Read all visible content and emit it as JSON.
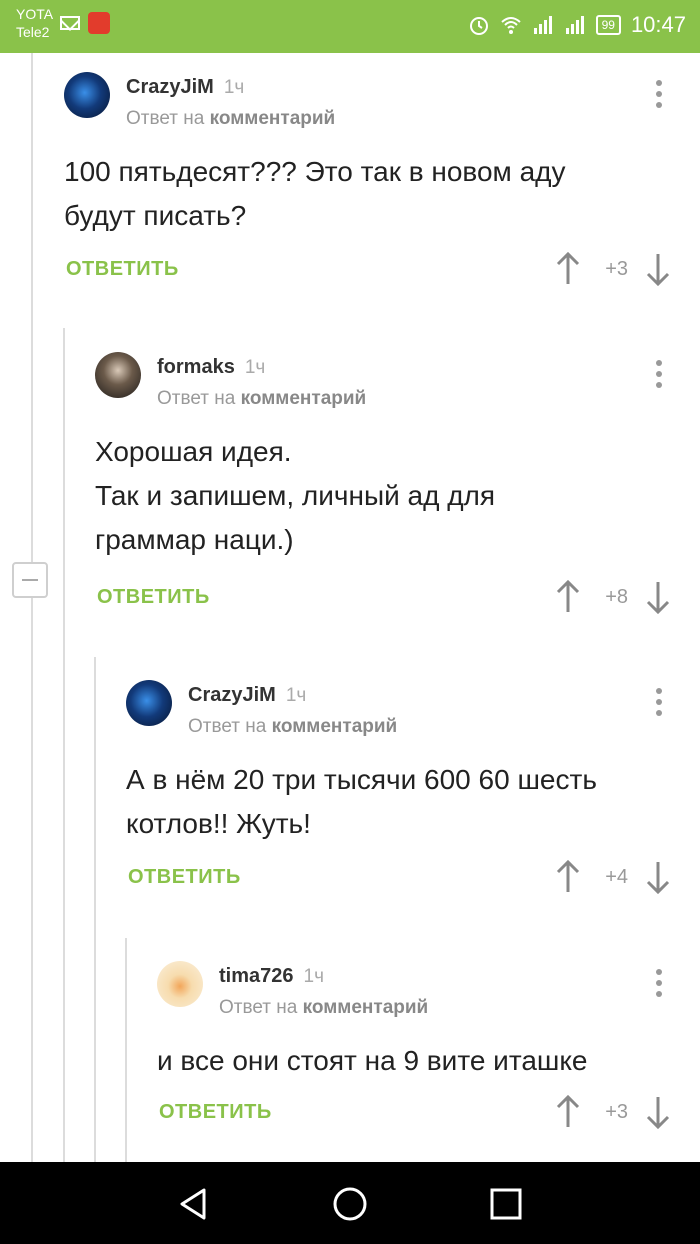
{
  "status_bar": {
    "carrier1": "YOTA",
    "carrier2": "Tele2",
    "battery": "99",
    "time": "10:47"
  },
  "comments": [
    {
      "author": "CrazyJiM",
      "time": "1ч",
      "reply_prefix": "Ответ на",
      "reply_target": "комментарий",
      "text": "100 пятьдесят??? Это так в новом аду\nбудут писать?",
      "reply_label": "ОТВЕТИТЬ",
      "score": "+3"
    },
    {
      "author": "formaks",
      "time": "1ч",
      "reply_prefix": "Ответ на",
      "reply_target": "комментарий",
      "text": "Хорошая идея.\nТак и запишем, личный ад для\nграммар наци.)",
      "reply_label": "ОТВЕТИТЬ",
      "score": "+8"
    },
    {
      "author": "CrazyJiM",
      "time": "1ч",
      "reply_prefix": "Ответ на",
      "reply_target": "комментарий",
      "text": "А в нём 20 три тысячи 600 60 шесть\nкотлов!! Жуть!",
      "reply_label": "ОТВЕТИТЬ",
      "score": "+4"
    },
    {
      "author": "tima726",
      "time": "1ч",
      "reply_prefix": "Ответ на",
      "reply_target": "комментарий",
      "text": "и все они стоят на 9 вите иташке",
      "reply_label": "ОТВЕТИТЬ",
      "score": "+3"
    }
  ],
  "colors": {
    "accent": "#8ac24a",
    "status_bar": "#8ac24a",
    "nav_bar": "#000000"
  }
}
